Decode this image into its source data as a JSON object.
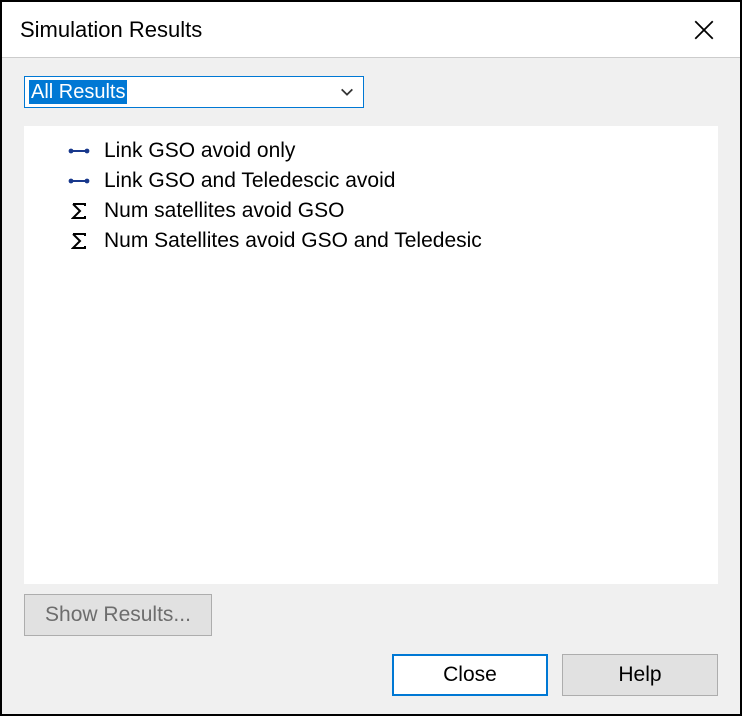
{
  "title": "Simulation Results",
  "filter": {
    "selected": "All Results"
  },
  "results": [
    {
      "icon": "link",
      "label": "Link GSO avoid only"
    },
    {
      "icon": "link",
      "label": "Link GSO and Teledescic avoid"
    },
    {
      "icon": "sigma",
      "label": "Num satellites avoid GSO"
    },
    {
      "icon": "sigma",
      "label": "Num Satellites avoid GSO and Teledesic"
    }
  ],
  "buttons": {
    "show_results": "Show Results...",
    "close": "Close",
    "help": "Help"
  }
}
